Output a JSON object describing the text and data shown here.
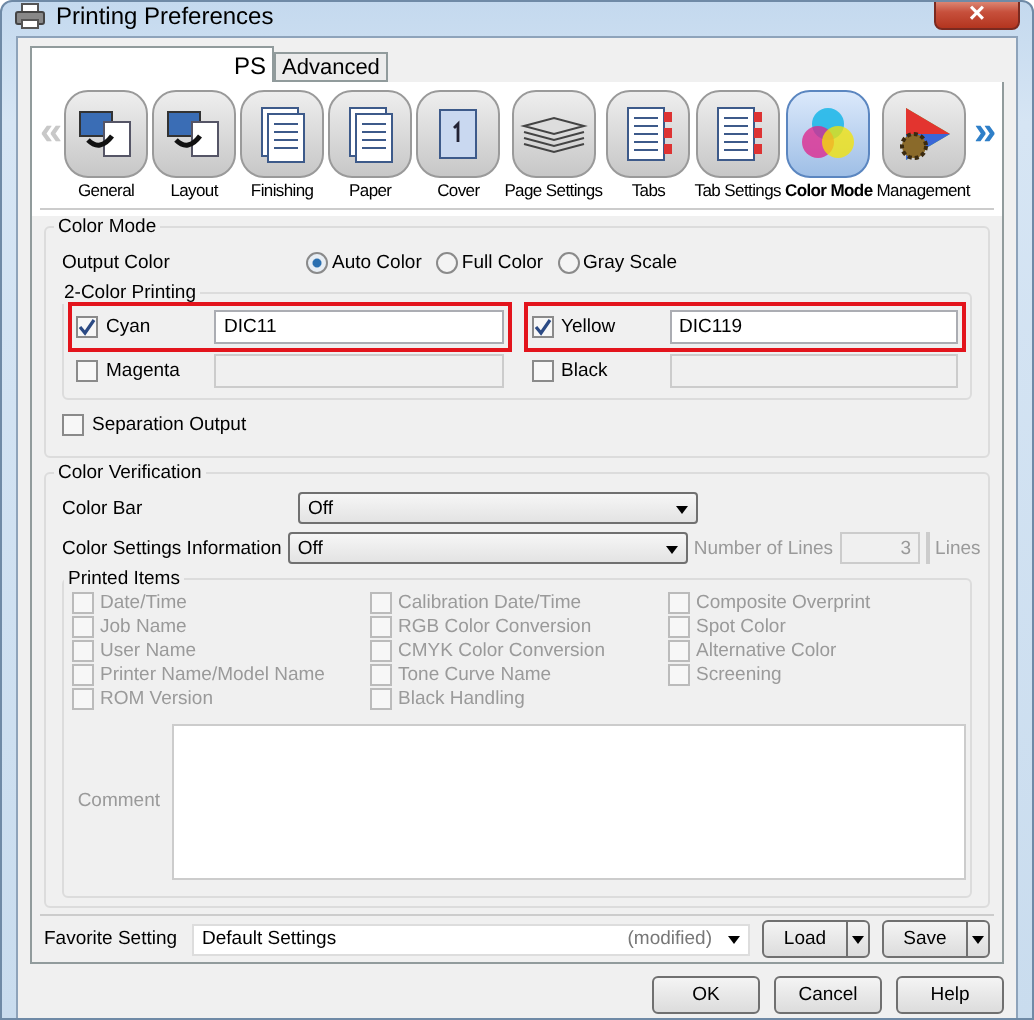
{
  "window": {
    "title": "Printing Preferences",
    "close": "×"
  },
  "tabs": [
    {
      "label": "PS",
      "selected": true
    },
    {
      "label": "Advanced",
      "selected": false
    }
  ],
  "nav": {
    "prev": "«",
    "next": "»",
    "items": [
      {
        "label": "General",
        "kind": "monitor",
        "selected": false
      },
      {
        "label": "Layout",
        "kind": "monitor",
        "selected": false
      },
      {
        "label": "Finishing",
        "kind": "document",
        "selected": false
      },
      {
        "label": "Paper",
        "kind": "document",
        "selected": false
      },
      {
        "label": "Cover",
        "kind": "cover",
        "selected": false
      },
      {
        "label": "Page Settings",
        "kind": "stack",
        "selected": false
      },
      {
        "label": "Tabs",
        "kind": "tabs",
        "selected": false
      },
      {
        "label": "Tab Settings",
        "kind": "tabs",
        "selected": false
      },
      {
        "label": "Color Mode",
        "kind": "circles",
        "selected": true
      },
      {
        "label": "Management",
        "kind": "prism",
        "selected": false
      }
    ]
  },
  "color_mode": {
    "title": "Color Mode",
    "output_label": "Output Color",
    "output_options": [
      {
        "label": "Auto Color",
        "selected": true
      },
      {
        "label": "Full Color",
        "selected": false
      },
      {
        "label": "Gray Scale",
        "selected": false
      }
    ],
    "two_color": {
      "title": "2-Color Printing",
      "rows": [
        [
          {
            "label": "Cyan",
            "checked": true,
            "value": "DIC11",
            "highlighted": true
          },
          {
            "label": "Yellow",
            "checked": true,
            "value": "DIC119",
            "highlighted": true
          }
        ],
        [
          {
            "label": "Magenta",
            "checked": false,
            "highlighted": false
          },
          {
            "label": "Black",
            "checked": false,
            "highlighted": false
          }
        ]
      ]
    },
    "separation": {
      "label": "Separation Output",
      "checked": false
    }
  },
  "verification": {
    "title": "Color Verification",
    "color_bar": {
      "label": "Color Bar",
      "value": "Off"
    },
    "settings_info": {
      "label": "Color Settings Information",
      "value": "Off",
      "lines_label": "Number of Lines",
      "lines_value": "3",
      "lines_unit": "Lines"
    },
    "printed_items": {
      "title": "Printed Items",
      "disabled": true,
      "columns": [
        [
          {
            "label": "Date/Time",
            "checked": false
          },
          {
            "label": "Job Name",
            "checked": false
          },
          {
            "label": "User Name",
            "checked": false
          },
          {
            "label": "Printer Name/Model Name",
            "checked": false
          },
          {
            "label": "ROM Version",
            "checked": false
          }
        ],
        [
          {
            "label": "Calibration Date/Time",
            "checked": false
          },
          {
            "label": "RGB Color Conversion",
            "checked": false
          },
          {
            "label": "CMYK Color Conversion",
            "checked": false
          },
          {
            "label": "Tone Curve Name",
            "checked": false
          },
          {
            "label": "Black Handling",
            "checked": false
          }
        ],
        [
          {
            "label": "Composite Overprint",
            "checked": false
          },
          {
            "label": "Spot Color",
            "checked": false
          },
          {
            "label": "Alternative Color",
            "checked": false
          },
          {
            "label": "Screening",
            "checked": false
          }
        ]
      ],
      "comment_label": "Comment"
    }
  },
  "favorite": {
    "label": "Favorite Setting",
    "value": "Default Settings",
    "status": "(modified)",
    "load": "Load",
    "save": "Save"
  },
  "buttons": [
    "OK",
    "Cancel",
    "Help"
  ]
}
